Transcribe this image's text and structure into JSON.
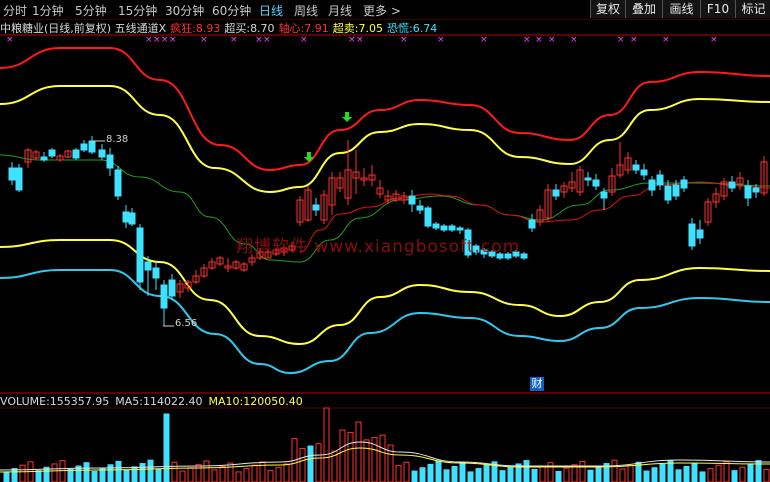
{
  "toolbar": {
    "periods": [
      "分时",
      "1分钟",
      "5分钟",
      "15分钟",
      "30分钟",
      "60分钟",
      "日线",
      "周线",
      "月线",
      "更多 >"
    ],
    "active_period": "日线",
    "buttons": [
      "复权",
      "叠加",
      "画线",
      "F10",
      "标记"
    ]
  },
  "indicator": {
    "name": "中粮糖业(日线,前复权) 五线通道X",
    "items": [
      {
        "label": "疯狂:",
        "value": "8.93",
        "color": "#ff3030"
      },
      {
        "label": "超买:",
        "value": "8.70",
        "color": "#d8d8d8"
      },
      {
        "label": "轴心:",
        "value": "7.91",
        "color": "#ff3030"
      },
      {
        "label": "超卖:",
        "value": "7.05",
        "color": "#ffff40"
      },
      {
        "label": "恐慌:",
        "value": "6.74",
        "color": "#40e0ff"
      }
    ]
  },
  "annotations": {
    "high": "8.38",
    "low": "6.56",
    "finance_marker": "财"
  },
  "watermark": "翔博软件 www.xiangbosoft.com",
  "volume": {
    "items": [
      {
        "label": "VOLUME:",
        "value": "155357.95",
        "color": "#d8d8d8"
      },
      {
        "label": "MA5:",
        "value": "114022.40",
        "color": "#d8d8d8"
      },
      {
        "label": "MA10:",
        "value": "120050.40",
        "color": "#ffff40"
      }
    ]
  },
  "colors": {
    "up": "#ff3030",
    "down": "#40e0ff",
    "crazy": "#ff1a1a",
    "overbought": "#ffff40",
    "axis": "#20a020",
    "panic": "#30c8f0",
    "oversold": "#ffff40",
    "mark": "#ff40ff",
    "arrow": "#22dd22",
    "border": "#c00000"
  }
}
